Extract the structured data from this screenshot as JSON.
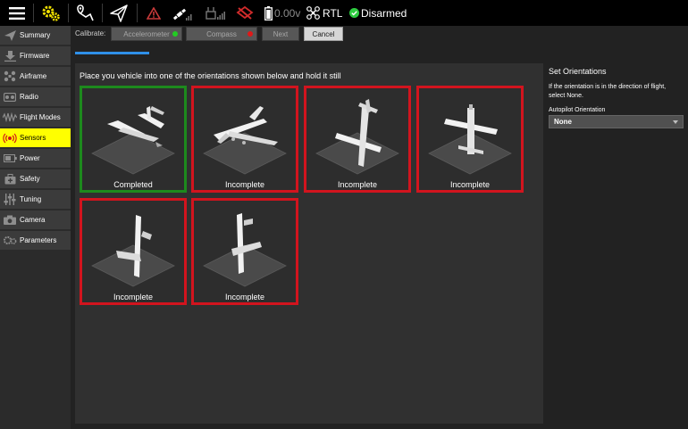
{
  "toolbar": {
    "rtl_label": "RTL",
    "battery_label": "0.00v",
    "arm_status": "Disarmed"
  },
  "sidebar": {
    "items": [
      {
        "label": "Summary",
        "icon": "paper-plane-icon"
      },
      {
        "label": "Firmware",
        "icon": "download-icon"
      },
      {
        "label": "Airframe",
        "icon": "airframe-icon"
      },
      {
        "label": "Radio",
        "icon": "radio-icon"
      },
      {
        "label": "Flight Modes",
        "icon": "waveform-icon"
      },
      {
        "label": "Sensors",
        "icon": "sensors-icon"
      },
      {
        "label": "Power",
        "icon": "battery-icon"
      },
      {
        "label": "Safety",
        "icon": "safety-icon"
      },
      {
        "label": "Tuning",
        "icon": "sliders-icon"
      },
      {
        "label": "Camera",
        "icon": "camera-icon"
      },
      {
        "label": "Parameters",
        "icon": "gears-icon"
      }
    ],
    "active": "Sensors"
  },
  "calibrate": {
    "label": "Calibrate:",
    "accelerometer": "Accelerometer",
    "compass": "Compass",
    "next": "Next",
    "cancel": "Cancel",
    "accelerometer_status_color": "#22cc22",
    "compass_status_color": "#e01818",
    "progress": 0.16
  },
  "main": {
    "instruction": "Place you vehicle into one of the orientations shown below and hold it still",
    "tiles": [
      {
        "status": "Completed",
        "complete": true
      },
      {
        "status": "Incomplete",
        "complete": false
      },
      {
        "status": "Incomplete",
        "complete": false
      },
      {
        "status": "Incomplete",
        "complete": false
      },
      {
        "status": "Incomplete",
        "complete": false
      },
      {
        "status": "Incomplete",
        "complete": false
      }
    ]
  },
  "right": {
    "title": "Set Orientations",
    "description": "If the orientation is in the direction of flight, select None.",
    "autopilot_label": "Autopilot Orientation",
    "autopilot_value": "None"
  },
  "colors": {
    "accent_yellow": "#ffff00",
    "complete_border": "#1d8a1d",
    "incomplete_border": "#d2141e",
    "armed_green": "#2ecc40"
  }
}
